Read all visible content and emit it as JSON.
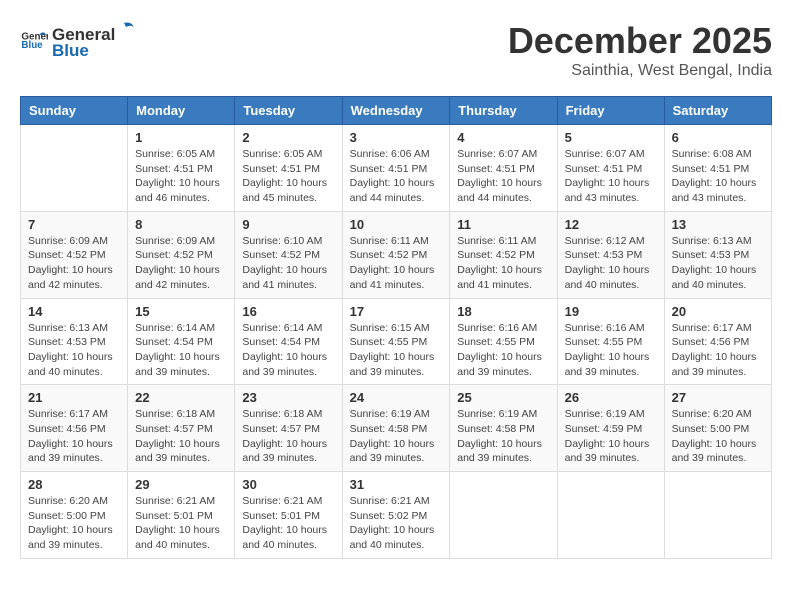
{
  "logo": {
    "general": "General",
    "blue": "Blue"
  },
  "title": "December 2025",
  "location": "Sainthia, West Bengal, India",
  "weekdays": [
    "Sunday",
    "Monday",
    "Tuesday",
    "Wednesday",
    "Thursday",
    "Friday",
    "Saturday"
  ],
  "weeks": [
    [
      {
        "day": "",
        "info": ""
      },
      {
        "day": "1",
        "info": "Sunrise: 6:05 AM\nSunset: 4:51 PM\nDaylight: 10 hours\nand 46 minutes."
      },
      {
        "day": "2",
        "info": "Sunrise: 6:05 AM\nSunset: 4:51 PM\nDaylight: 10 hours\nand 45 minutes."
      },
      {
        "day": "3",
        "info": "Sunrise: 6:06 AM\nSunset: 4:51 PM\nDaylight: 10 hours\nand 44 minutes."
      },
      {
        "day": "4",
        "info": "Sunrise: 6:07 AM\nSunset: 4:51 PM\nDaylight: 10 hours\nand 44 minutes."
      },
      {
        "day": "5",
        "info": "Sunrise: 6:07 AM\nSunset: 4:51 PM\nDaylight: 10 hours\nand 43 minutes."
      },
      {
        "day": "6",
        "info": "Sunrise: 6:08 AM\nSunset: 4:51 PM\nDaylight: 10 hours\nand 43 minutes."
      }
    ],
    [
      {
        "day": "7",
        "info": "Sunrise: 6:09 AM\nSunset: 4:52 PM\nDaylight: 10 hours\nand 42 minutes."
      },
      {
        "day": "8",
        "info": "Sunrise: 6:09 AM\nSunset: 4:52 PM\nDaylight: 10 hours\nand 42 minutes."
      },
      {
        "day": "9",
        "info": "Sunrise: 6:10 AM\nSunset: 4:52 PM\nDaylight: 10 hours\nand 41 minutes."
      },
      {
        "day": "10",
        "info": "Sunrise: 6:11 AM\nSunset: 4:52 PM\nDaylight: 10 hours\nand 41 minutes."
      },
      {
        "day": "11",
        "info": "Sunrise: 6:11 AM\nSunset: 4:52 PM\nDaylight: 10 hours\nand 41 minutes."
      },
      {
        "day": "12",
        "info": "Sunrise: 6:12 AM\nSunset: 4:53 PM\nDaylight: 10 hours\nand 40 minutes."
      },
      {
        "day": "13",
        "info": "Sunrise: 6:13 AM\nSunset: 4:53 PM\nDaylight: 10 hours\nand 40 minutes."
      }
    ],
    [
      {
        "day": "14",
        "info": "Sunrise: 6:13 AM\nSunset: 4:53 PM\nDaylight: 10 hours\nand 40 minutes."
      },
      {
        "day": "15",
        "info": "Sunrise: 6:14 AM\nSunset: 4:54 PM\nDaylight: 10 hours\nand 39 minutes."
      },
      {
        "day": "16",
        "info": "Sunrise: 6:14 AM\nSunset: 4:54 PM\nDaylight: 10 hours\nand 39 minutes."
      },
      {
        "day": "17",
        "info": "Sunrise: 6:15 AM\nSunset: 4:55 PM\nDaylight: 10 hours\nand 39 minutes."
      },
      {
        "day": "18",
        "info": "Sunrise: 6:16 AM\nSunset: 4:55 PM\nDaylight: 10 hours\nand 39 minutes."
      },
      {
        "day": "19",
        "info": "Sunrise: 6:16 AM\nSunset: 4:55 PM\nDaylight: 10 hours\nand 39 minutes."
      },
      {
        "day": "20",
        "info": "Sunrise: 6:17 AM\nSunset: 4:56 PM\nDaylight: 10 hours\nand 39 minutes."
      }
    ],
    [
      {
        "day": "21",
        "info": "Sunrise: 6:17 AM\nSunset: 4:56 PM\nDaylight: 10 hours\nand 39 minutes."
      },
      {
        "day": "22",
        "info": "Sunrise: 6:18 AM\nSunset: 4:57 PM\nDaylight: 10 hours\nand 39 minutes."
      },
      {
        "day": "23",
        "info": "Sunrise: 6:18 AM\nSunset: 4:57 PM\nDaylight: 10 hours\nand 39 minutes."
      },
      {
        "day": "24",
        "info": "Sunrise: 6:19 AM\nSunset: 4:58 PM\nDaylight: 10 hours\nand 39 minutes."
      },
      {
        "day": "25",
        "info": "Sunrise: 6:19 AM\nSunset: 4:58 PM\nDaylight: 10 hours\nand 39 minutes."
      },
      {
        "day": "26",
        "info": "Sunrise: 6:19 AM\nSunset: 4:59 PM\nDaylight: 10 hours\nand 39 minutes."
      },
      {
        "day": "27",
        "info": "Sunrise: 6:20 AM\nSunset: 5:00 PM\nDaylight: 10 hours\nand 39 minutes."
      }
    ],
    [
      {
        "day": "28",
        "info": "Sunrise: 6:20 AM\nSunset: 5:00 PM\nDaylight: 10 hours\nand 39 minutes."
      },
      {
        "day": "29",
        "info": "Sunrise: 6:21 AM\nSunset: 5:01 PM\nDaylight: 10 hours\nand 40 minutes."
      },
      {
        "day": "30",
        "info": "Sunrise: 6:21 AM\nSunset: 5:01 PM\nDaylight: 10 hours\nand 40 minutes."
      },
      {
        "day": "31",
        "info": "Sunrise: 6:21 AM\nSunset: 5:02 PM\nDaylight: 10 hours\nand 40 minutes."
      },
      {
        "day": "",
        "info": ""
      },
      {
        "day": "",
        "info": ""
      },
      {
        "day": "",
        "info": ""
      }
    ]
  ]
}
